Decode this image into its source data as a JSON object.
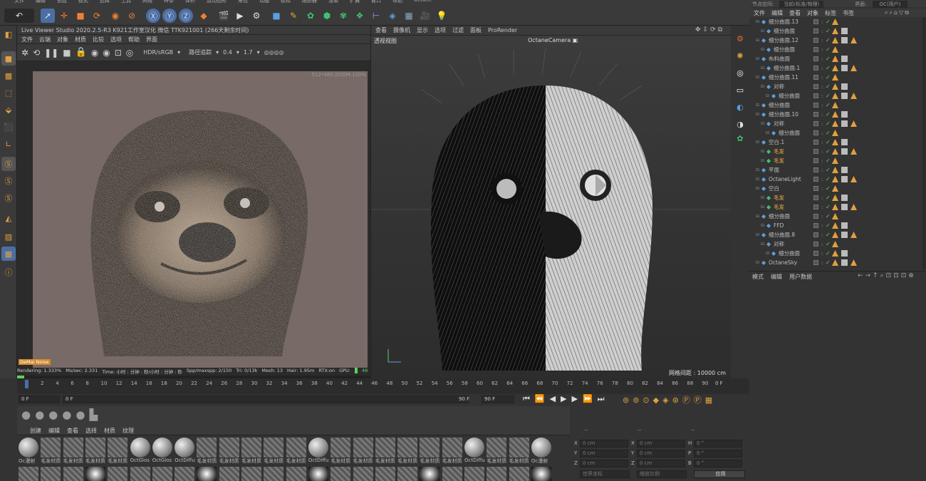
{
  "top_menu": {
    "items": [
      "文件",
      "编辑",
      "创建",
      "模式",
      "选择",
      "工具",
      "网格",
      "样条",
      "体积",
      "运动图形",
      "角色",
      "动画",
      "模拟",
      "跟踪器",
      "渲染",
      "扩展",
      "窗口",
      "帮助",
      "Octane"
    ]
  },
  "live_viewer": {
    "title": "Live Viewer Studio 2020.2.5-R3   K921工作室汉化  微信   TTK921001   (266天剩余时间)",
    "menu": [
      "文件",
      "云端",
      "对象",
      "材质",
      "比较",
      "选项",
      "帮助",
      "界面"
    ],
    "color_space": "HDR/sRGB",
    "tracing_label": "路径追踪",
    "value_a": "0.4",
    "value_b": "1.7",
    "resolution_label": "512*480 ZOOM:100%",
    "noise_badge": "DeMai Noise",
    "status": {
      "rendering": "Rendering: 1.333%",
      "ms": "Ms/sec: 2.331",
      "time": "Time: 小时 : 分钟 : 秒/小时 : 分钟 : 秒",
      "spp": "Spp/maxspp: 2/150",
      "tri": "Tri: 0/13k",
      "mesh": "Mesh: 13",
      "hair": "Hair: 1.95m",
      "rtx": "RTX:on",
      "gpu": "GPU:",
      "gpu_val": "48"
    }
  },
  "viewport": {
    "menu": [
      "查看",
      "摄像机",
      "显示",
      "选项",
      "过滤",
      "面板",
      "ProRender"
    ],
    "label": "透视视图",
    "camera": "OctaneCamera",
    "grid": "网格间距 : 10000 cm"
  },
  "object_manager": {
    "header_left": "节点空间:",
    "header_node": "当前(标准/物理)",
    "header_right_label": "界面:",
    "header_right_val": "OC(用户)",
    "menu": [
      "文件",
      "编辑",
      "查看",
      "对象",
      "标签",
      "书签"
    ],
    "rows": [
      {
        "name": "细分曲面.13",
        "indent": 1
      },
      {
        "name": "细分曲面",
        "indent": 2
      },
      {
        "name": "细分曲面.12",
        "indent": 1
      },
      {
        "name": "细分曲面",
        "indent": 2
      },
      {
        "name": "布料曲面",
        "indent": 1
      },
      {
        "name": "细分曲面.1",
        "indent": 2
      },
      {
        "name": "细分曲面.11",
        "indent": 1
      },
      {
        "name": "对称",
        "indent": 2
      },
      {
        "name": "细分曲面",
        "indent": 3
      },
      {
        "name": "细分曲面",
        "indent": 1
      },
      {
        "name": "细分曲面.10",
        "indent": 1
      },
      {
        "name": "对称",
        "indent": 2
      },
      {
        "name": "细分曲面",
        "indent": 3
      },
      {
        "name": "空白.1",
        "indent": 1
      },
      {
        "name": "毛发",
        "indent": 2,
        "hl": true
      },
      {
        "name": "毛发",
        "indent": 2,
        "hl": true
      },
      {
        "name": "平面",
        "indent": 1
      },
      {
        "name": "OctaneLight",
        "indent": 1
      },
      {
        "name": "空白",
        "indent": 1
      },
      {
        "name": "毛发",
        "indent": 2,
        "hl": true
      },
      {
        "name": "毛发",
        "indent": 2,
        "hl": true
      },
      {
        "name": "细分曲面",
        "indent": 1
      },
      {
        "name": "FFD",
        "indent": 2
      },
      {
        "name": "细分曲面.8",
        "indent": 1
      },
      {
        "name": "对称",
        "indent": 2
      },
      {
        "name": "细分曲面",
        "indent": 3
      },
      {
        "name": "OctaneSky",
        "indent": 1
      }
    ]
  },
  "attributes": {
    "menu": [
      "模式",
      "编辑",
      "用户数据"
    ]
  },
  "timeline": {
    "ticks": [
      "0",
      "2",
      "4",
      "6",
      "8",
      "10",
      "12",
      "14",
      "16",
      "18",
      "20",
      "22",
      "24",
      "26",
      "28",
      "30",
      "32",
      "34",
      "36",
      "38",
      "40",
      "42",
      "44",
      "46",
      "48",
      "50",
      "52",
      "54",
      "56",
      "58",
      "60",
      "62",
      "64",
      "66",
      "68",
      "70",
      "72",
      "74",
      "76",
      "78",
      "80",
      "82",
      "84",
      "86",
      "88",
      "90"
    ],
    "end_label": "0 F"
  },
  "transport": {
    "start": "0 F",
    "current": "0 F",
    "end": "90 F",
    "end2": "90 F"
  },
  "materials": {
    "menu": [
      "创建",
      "编辑",
      "查看",
      "选择",
      "材质",
      "纹理"
    ],
    "row1": [
      "Oc漫射",
      "毛发材质",
      "毛发材质",
      "毛发材质",
      "毛发材质",
      "OctGlos",
      "OctGlos",
      "OctDiffu",
      "毛发材质",
      "毛发材质",
      "毛发材质",
      "毛发材质",
      "毛发材质",
      "OctDiffu",
      "毛发材质",
      "毛发材质",
      "毛发材质",
      "毛发材质",
      "毛发材质",
      "毛发材质",
      "OctDiffu",
      "毛发材质",
      "毛发材质",
      "Oc漫射"
    ]
  },
  "coords": {
    "header": [
      "--",
      "--",
      "--"
    ],
    "rows": [
      {
        "a": "X",
        "av": "0 cm",
        "b": "X",
        "bv": "0 cm",
        "c": "H",
        "cv": "0 °"
      },
      {
        "a": "Y",
        "av": "0 cm",
        "b": "Y",
        "bv": "0 cm",
        "c": "P",
        "cv": "0 °"
      },
      {
        "a": "Z",
        "av": "0 cm",
        "b": "Z",
        "bv": "0 cm",
        "c": "B",
        "cv": "0 °"
      }
    ],
    "mode": "世界坐标",
    "scale": "缩放比例",
    "apply": "应用"
  },
  "colors": {
    "accent": "#4a6fa5",
    "orange": "#e0a040",
    "green": "#5fce5f",
    "bg": "#333333"
  }
}
